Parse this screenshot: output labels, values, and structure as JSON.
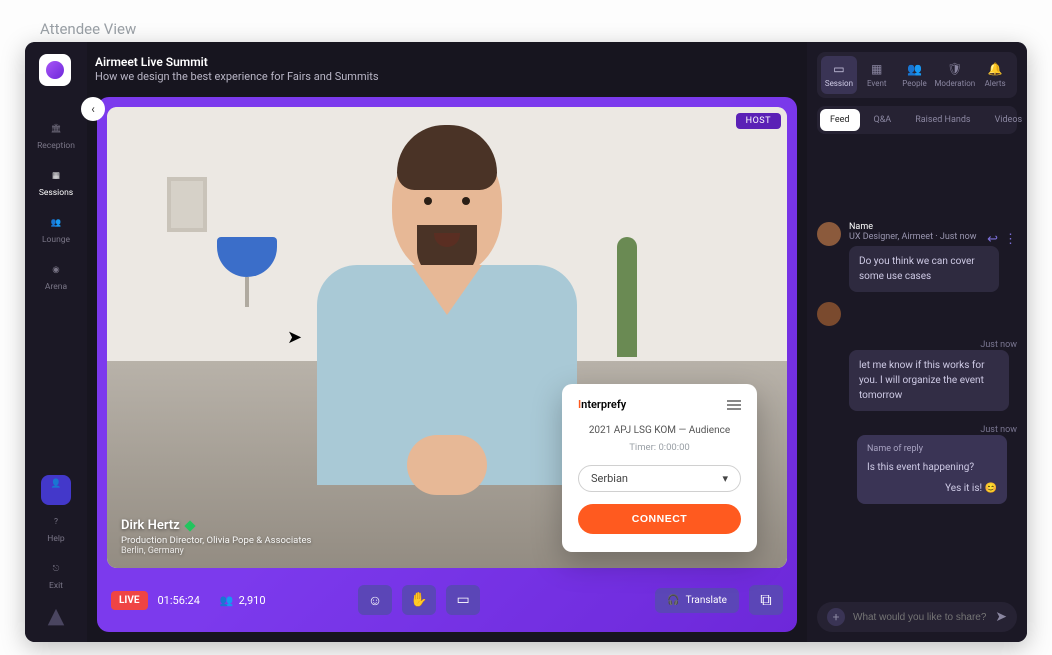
{
  "frame_title": "Attendee View",
  "header": {
    "title": "Airmeet Live Summit",
    "subtitle": "How we design the best experience for Fairs and Summits"
  },
  "leftnav": {
    "reception": "Reception",
    "sessions": "Sessions",
    "lounge": "Lounge",
    "arena": "Arena",
    "help": "Help",
    "exit": "Exit"
  },
  "stage": {
    "host_badge": "HOST",
    "speaker_name": "Dirk Hertz",
    "speaker_role": "Production Director, Olivia Pope & Associates",
    "speaker_location": "Berlin, Germany",
    "live_label": "LIVE",
    "timecode": "01:56:24",
    "attendee_count": "2,910",
    "translate_label": "Translate"
  },
  "translate_popup": {
    "brand_prefix": "I",
    "brand_rest": "nterprefy",
    "event_line": "2021 APJ LSG KOM — Audience",
    "timer_label": "Timer:",
    "timer_value": "0:00:00",
    "language": "Serbian",
    "connect": "CONNECT"
  },
  "right": {
    "tabs_top": {
      "session": "Session",
      "event": "Event",
      "people": "People",
      "moderation": "Moderation",
      "alerts": "Alerts"
    },
    "feed_tabs": {
      "feed": "Feed",
      "qa": "Q&A",
      "raised": "Raised Hands",
      "videos": "Videos"
    },
    "msg1": {
      "name": "Name",
      "role": "UX Designer, Airmeet",
      "time": "Just now",
      "text": "Do you think we can cover some use cases"
    },
    "ts2": "Just now",
    "msg2": "let me know if this works for you. I will organize the event tomorrow",
    "ts3": "Just now",
    "msg3": {
      "reply_name": "Name of reply",
      "question": "Is this event happening?",
      "answer": "Yes it is! 😊"
    },
    "input_placeholder": "What would you like to share?"
  }
}
